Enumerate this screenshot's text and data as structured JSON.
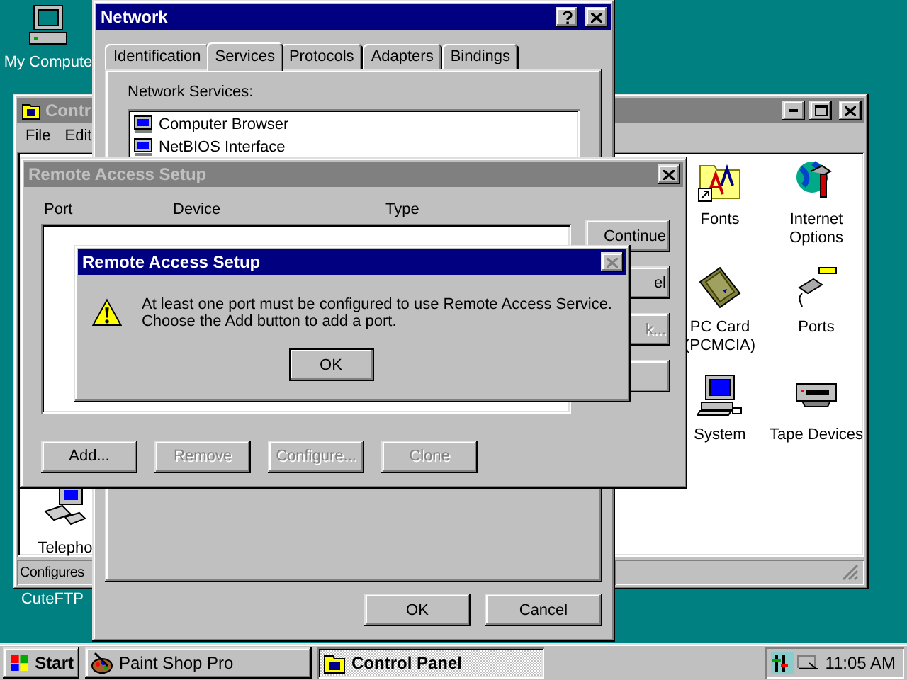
{
  "desktop_icons": [
    {
      "label": "My Compute",
      "kind": "computer"
    },
    {
      "label": "CuteFTP",
      "kind": "blank"
    }
  ],
  "control_panel": {
    "title": "Contr",
    "active": false,
    "menu": [
      "File",
      "Edit"
    ],
    "icons": [
      {
        "label": "Fonts",
        "kind": "fonts"
      },
      {
        "label": "Internet Options",
        "kind": "internet"
      },
      {
        "label": "PC Card (PCMCIA)",
        "kind": "pccard"
      },
      {
        "label": "Ports",
        "kind": "ports"
      },
      {
        "label": "System",
        "kind": "system"
      },
      {
        "label": "Tape Devices",
        "kind": "tape"
      },
      {
        "label": "Telepho",
        "kind": "telephony"
      }
    ],
    "status": "Configures"
  },
  "network": {
    "title": "Network",
    "active": true,
    "tabs": [
      {
        "label": "Identification",
        "selected": false
      },
      {
        "label": "Services",
        "selected": true
      },
      {
        "label": "Protocols",
        "selected": false
      },
      {
        "label": "Adapters",
        "selected": false
      },
      {
        "label": "Bindings",
        "selected": false
      }
    ],
    "list_label": "Network Services:",
    "services": [
      "Computer Browser",
      "NetBIOS Interface"
    ],
    "buttons": [
      "OK",
      "Cancel"
    ]
  },
  "remote_access": {
    "title": "Remote Access Setup",
    "active": false,
    "columns": [
      "Port",
      "Device",
      "Type"
    ],
    "side_buttons": [
      {
        "label": "Continue",
        "disabled": false
      },
      {
        "label": "el",
        "disabled": false
      },
      {
        "label": "k...",
        "disabled": true
      }
    ],
    "buttons": [
      {
        "label": "Add...",
        "disabled": false
      },
      {
        "label": "Remove",
        "disabled": true
      },
      {
        "label": "Configure...",
        "disabled": true
      },
      {
        "label": "Clone",
        "disabled": true
      }
    ]
  },
  "message": {
    "title": "Remote Access Setup",
    "active": true,
    "lines": [
      "At least one port must be configured to use Remote Access Service.",
      "Choose the Add button to add a port."
    ],
    "ok": "OK"
  },
  "taskbar": {
    "start": "Start",
    "tasks": [
      {
        "label": "Paint Shop Pro",
        "selected": false,
        "kind": "paint"
      },
      {
        "label": "Control Panel",
        "selected": true,
        "kind": "panel"
      }
    ],
    "clock": "11:05 AM"
  }
}
